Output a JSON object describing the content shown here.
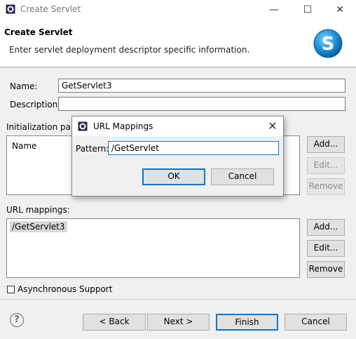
{
  "window": {
    "title": "Create Servlet",
    "minimize_glyph": "—",
    "maximize_glyph": "☐",
    "close_glyph": "✕"
  },
  "header": {
    "title": "Create Servlet",
    "description": "Enter servlet deployment descriptor specific information.",
    "logo_letter": "S"
  },
  "form": {
    "name_label": "Name:",
    "name_value": "GetServlet3",
    "description_label": "Description:",
    "description_value": "",
    "init_params_label": "Initialization para",
    "init_params_column": "Name",
    "init_buttons": {
      "add": "Add...",
      "edit": "Edit...",
      "remove": "Remove"
    },
    "url_mappings_label": "URL mappings:",
    "url_mappings": [
      "/GetServlet3"
    ],
    "url_buttons": {
      "add": "Add...",
      "edit": "Edit...",
      "remove": "Remove"
    },
    "async_label": "Asynchronous Support",
    "async_checked": false
  },
  "footer": {
    "help_glyph": "?",
    "back": "< Back",
    "next": "Next >",
    "finish": "Finish",
    "cancel": "Cancel"
  },
  "dialog": {
    "title": "URL Mappings",
    "close_glyph": "✕",
    "pattern_label": "Pattern:",
    "pattern_value": "/GetServlet",
    "ok": "OK",
    "cancel": "Cancel"
  },
  "colors": {
    "accent": "#0078d7",
    "logo_blue": "#1e90d6"
  }
}
